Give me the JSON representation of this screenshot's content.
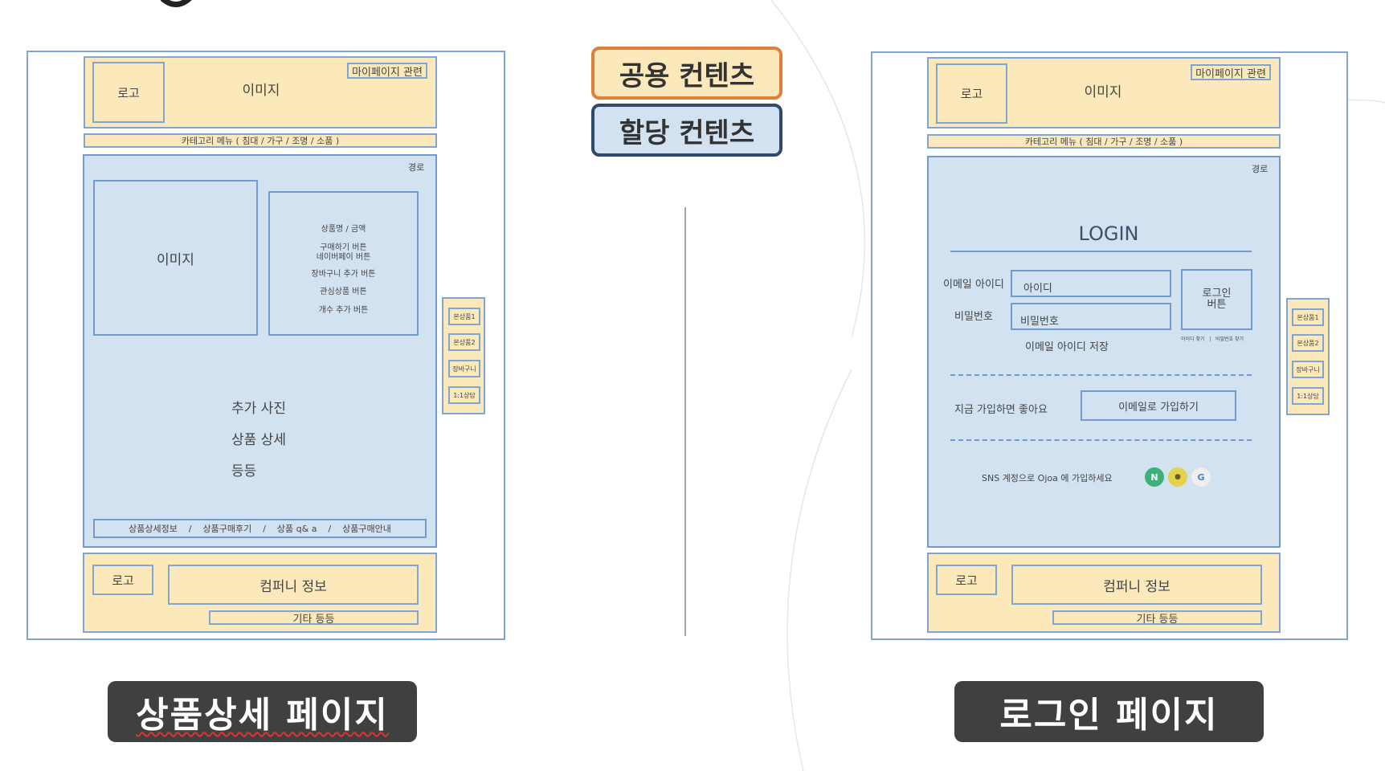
{
  "legend": {
    "shared": "공용 컨텐츠",
    "assigned": "할당 컨텐츠",
    "shared_color": "#fce9bb",
    "shared_border": "#e07f3a",
    "assigned_color": "#d3e2f1",
    "assigned_border": "#2f4a6a"
  },
  "product_page": {
    "caption": "상품상세 페이지",
    "header": {
      "logo": "로고",
      "image": "이미지",
      "mypage": "마이페이지 관련"
    },
    "category_menu": "카테고리 메뉴 ( 침대 / 가구 / 조명 / 소품 )",
    "route": "경로",
    "main_image": "이미지",
    "info_items": [
      "상품명 / 금액",
      "구매하기 버튼",
      "네이버페이 버튼",
      "장바구니 추가 버튼",
      "관심상품 버튼",
      "개수 추가 버튼"
    ],
    "details": [
      "추가 사진",
      "상품 상세",
      "등등"
    ],
    "tabs": "상품상세정보    /    상품구매후기    /    상품 q& a    /    상품구매안내",
    "footer": {
      "logo": "로고",
      "company": "컴퍼니 정보",
      "etc": "기타 등등"
    },
    "side": [
      "본상품1",
      "본상품2",
      "장바구니",
      "1:1상담"
    ]
  },
  "login_page": {
    "caption": "로그인 페이지",
    "header": {
      "logo": "로고",
      "image": "이미지",
      "mypage": "마이페이지 관련"
    },
    "category_menu": "카테고리 메뉴 ( 침대 / 가구 / 조명 / 소품 )",
    "route": "경로",
    "title": "LOGIN",
    "email_label": "이메일 아이디",
    "email_placeholder": "아이디",
    "password_label": "비밀번호",
    "password_placeholder": "비밀번호",
    "login_button": "로그인\n버튼",
    "find_links": "아이디 찾기   |   비밀번호 찾기",
    "save_id": "이메일 아이디 저장",
    "join_prompt": "지금 가입하면 좋아요",
    "join_button": "이메일로 가입하기",
    "sns_prompt": "SNS 계정으로 Ojoa 에 가입하세요",
    "sns_icons": [
      {
        "name": "naver-icon",
        "glyph": "N",
        "color": "#3fb07a"
      },
      {
        "name": "kakao-icon",
        "glyph": "●",
        "color": "#e3d34a"
      },
      {
        "name": "google-icon",
        "glyph": "G",
        "color": "#eeeeee"
      }
    ],
    "footer": {
      "logo": "로고",
      "company": "컴퍼니 정보",
      "etc": "기타 등등"
    },
    "side": [
      "본상품1",
      "본상품2",
      "장바구니",
      "1:1상담"
    ]
  }
}
